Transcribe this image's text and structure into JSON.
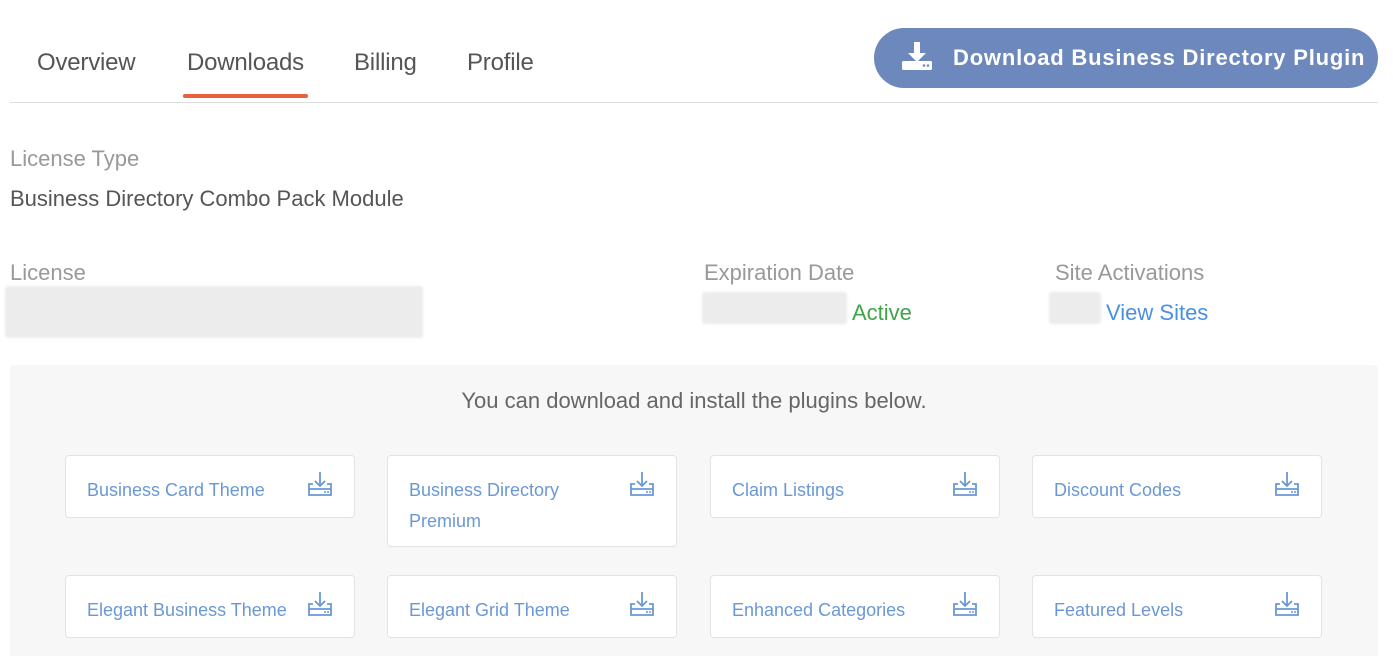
{
  "tabs": [
    {
      "label": "Overview",
      "active": false
    },
    {
      "label": "Downloads",
      "active": true
    },
    {
      "label": "Billing",
      "active": false
    },
    {
      "label": "Profile",
      "active": false
    }
  ],
  "main_button": {
    "label": "Download Business Directory Plugin",
    "icon": "download-icon"
  },
  "license_type": {
    "label": "License Type",
    "value": "Business Directory Combo Pack Module"
  },
  "license": {
    "label": "License"
  },
  "expiration": {
    "label": "Expiration Date",
    "status": "Active"
  },
  "site_activations": {
    "label": "Site Activations",
    "link": "View Sites"
  },
  "panel": {
    "intro": "You can download and install the plugins below."
  },
  "plugins": [
    {
      "name": "Business Card Theme"
    },
    {
      "name": "Business Directory Premium"
    },
    {
      "name": "Claim Listings"
    },
    {
      "name": "Discount Codes"
    },
    {
      "name": "Elegant Business Theme"
    },
    {
      "name": "Elegant Grid Theme"
    },
    {
      "name": "Enhanced Categories"
    },
    {
      "name": "Featured Levels"
    }
  ],
  "colors": {
    "accent": "#e8623b",
    "button": "#6d88bd",
    "link": "#4a90e2",
    "active": "#3fa548"
  }
}
